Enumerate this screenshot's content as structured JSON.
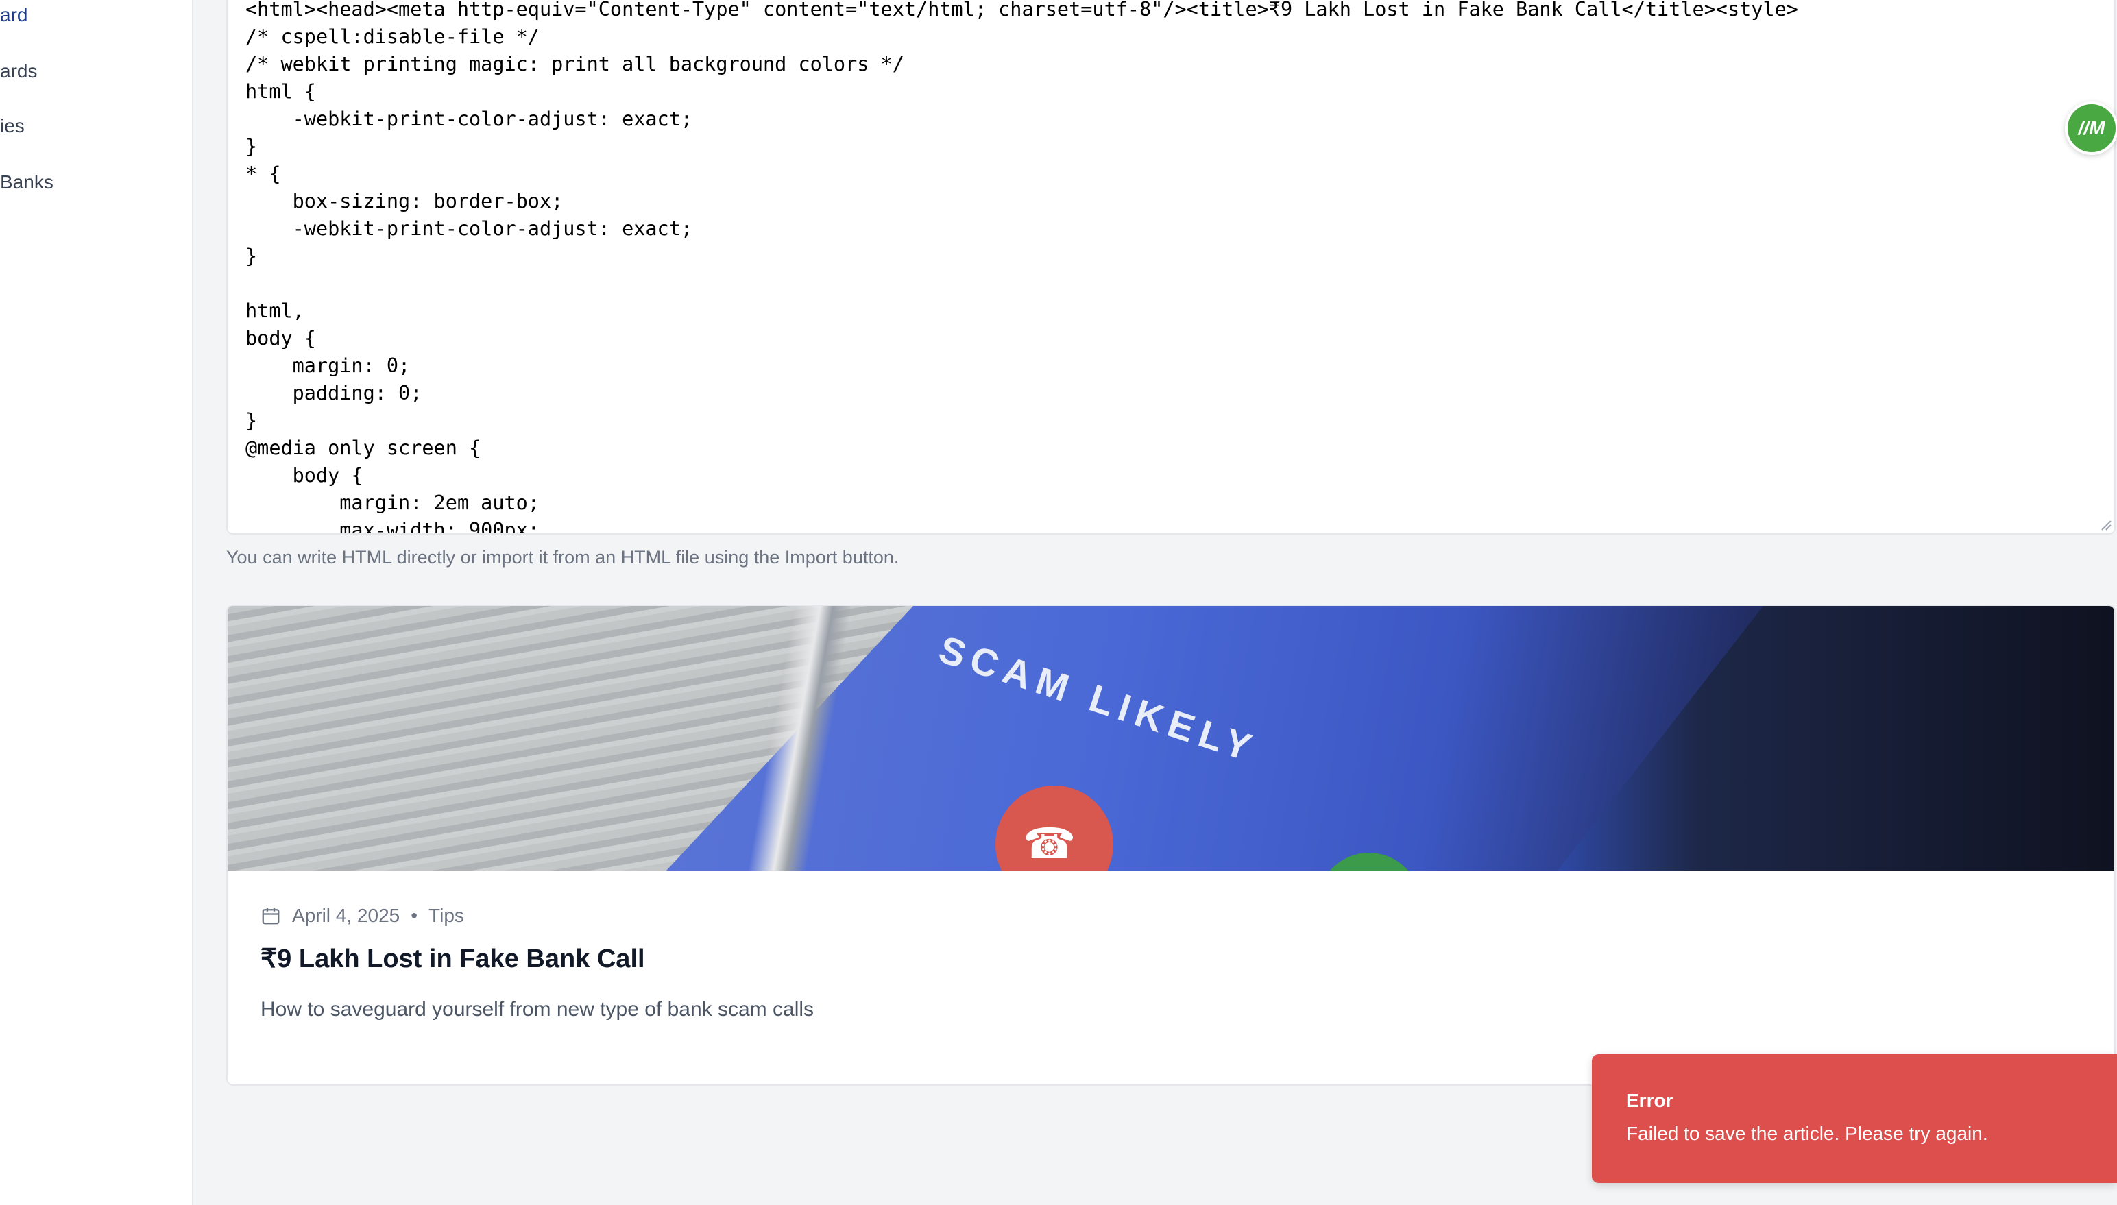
{
  "sidebar": {
    "items": [
      {
        "label": "ard",
        "active": true
      },
      {
        "label": "ards",
        "active": false
      },
      {
        "label": "ies",
        "active": false
      },
      {
        "label": "Banks",
        "active": false
      }
    ]
  },
  "editor": {
    "code": "<html><head><meta http-equiv=\"Content-Type\" content=\"text/html; charset=utf-8\"/><title>₹9 Lakh Lost in Fake Bank Call</title><style>\n/* cspell:disable-file */\n/* webkit printing magic: print all background colors */\nhtml {\n    -webkit-print-color-adjust: exact;\n}\n* {\n    box-sizing: border-box;\n    -webkit-print-color-adjust: exact;\n}\n\nhtml,\nbody {\n    margin: 0;\n    padding: 0;\n}\n@media only screen {\n    body {\n        margin: 2em auto;\n        max-width: 900px;",
    "helper_text": "You can write HTML directly or import it from an HTML file using the Import button."
  },
  "article": {
    "hero_caption": "SCAM LIKELY",
    "date": "April 4, 2025",
    "separator": "•",
    "category": "Tips",
    "title": "₹9 Lakh Lost in Fake Bank Call",
    "summary": "How to saveguard yourself from new type of bank scam calls"
  },
  "avatar": {
    "initials": "//M",
    "color": "#4aa843"
  },
  "toast": {
    "title": "Error",
    "message": "Failed to save the article. Please try again.",
    "color": "#dc4f4c"
  },
  "icons": {
    "calendar": "calendar-icon",
    "resize": "resize-handle-icon",
    "phone": "phone-decline-icon"
  }
}
